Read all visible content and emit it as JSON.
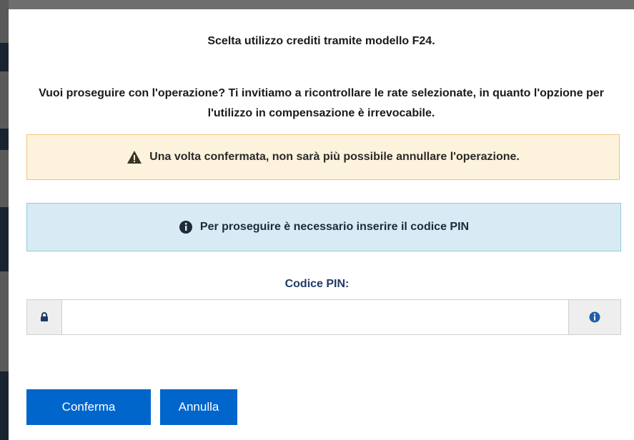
{
  "dialog": {
    "title": "Scelta utilizzo crediti tramite modello F24.",
    "question": "Vuoi proseguire con l'operazione? Ti invitiamo a ricontrollare le rate selezionate, in quanto l'opzione per l'utilizzo in compensazione è irrevocabile.",
    "warning": {
      "icon": "warning-triangle-icon",
      "text": "Una volta confermata, non sarà più possibile annullare l'operazione."
    },
    "info": {
      "icon": "info-circle-icon",
      "text": "Per proseguire è necessario inserire il codice PIN"
    },
    "pin": {
      "label": "Codice PIN:",
      "value": "",
      "placeholder": "",
      "left_icon": "lock-icon",
      "right_icon": "info-icon"
    },
    "buttons": {
      "confirm_label": "Conferma",
      "cancel_label": "Annulla"
    }
  },
  "colors": {
    "primary": "#0066cc",
    "warning_bg": "#fdf3dc",
    "warning_border": "#f0c27a",
    "info_bg": "#d8ebf4",
    "info_border": "#93c9df",
    "pin_label": "#1f3a66"
  }
}
